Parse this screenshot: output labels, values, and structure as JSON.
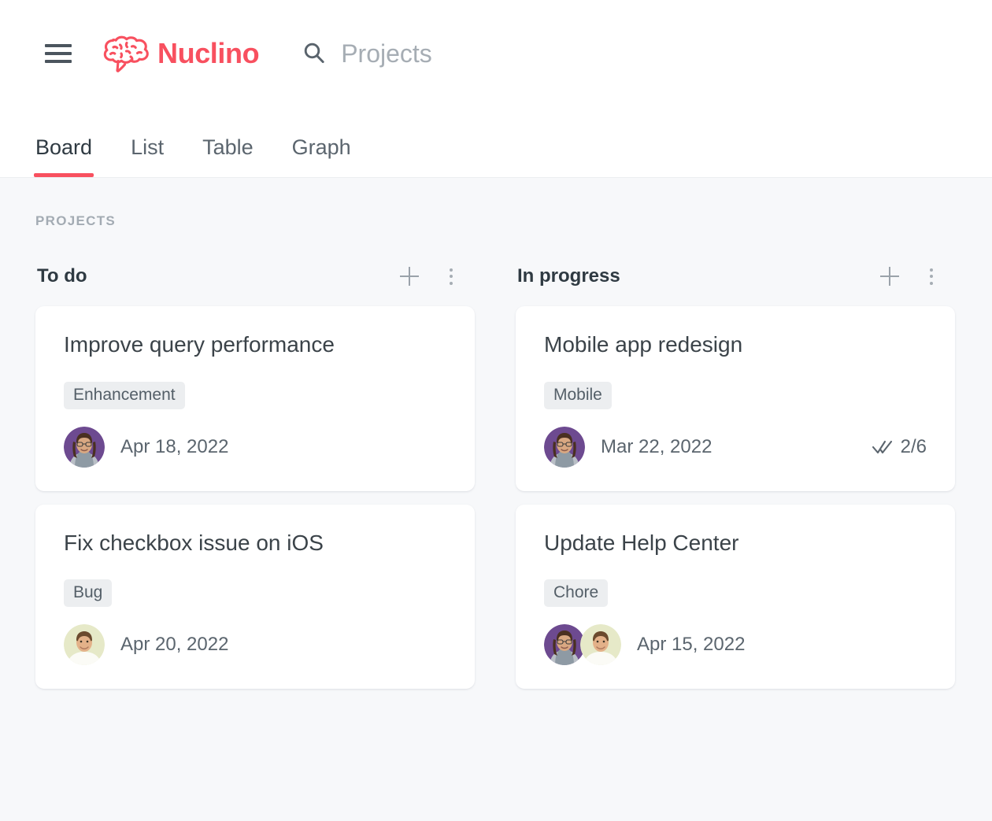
{
  "header": {
    "menu_icon": "hamburger-icon",
    "brand_name": "Nuclino",
    "brand_icon": "brain-speech-bubble-icon",
    "brand_color": "#f8505f",
    "search_icon": "search-icon",
    "search_value": "Projects"
  },
  "tabs": {
    "items": [
      {
        "label": "Board",
        "active": true
      },
      {
        "label": "List",
        "active": false
      },
      {
        "label": "Table",
        "active": false
      },
      {
        "label": "Graph",
        "active": false
      }
    ],
    "overflow_icon": "kebab-menu-icon",
    "active_underline_color": "#f8505f"
  },
  "board": {
    "label": "PROJECTS",
    "background_color": "#f7f8fa",
    "columns": [
      {
        "title": "To do",
        "add_icon": "plus-icon",
        "menu_icon": "kebab-menu-icon",
        "cards": [
          {
            "title": "Improve query performance",
            "tag": "Enhancement",
            "date": "Apr 18, 2022",
            "assignees": [
              "avatar-woman-purple"
            ],
            "progress": null,
            "progress_icon": null
          },
          {
            "title": "Fix checkbox issue on iOS",
            "tag": "Bug",
            "date": "Apr 20, 2022",
            "assignees": [
              "avatar-man-cream"
            ],
            "progress": null,
            "progress_icon": null
          }
        ]
      },
      {
        "title": "In progress",
        "add_icon": "plus-icon",
        "menu_icon": "kebab-menu-icon",
        "cards": [
          {
            "title": "Mobile app redesign",
            "tag": "Mobile",
            "date": "Mar 22, 2022",
            "assignees": [
              "avatar-woman-purple"
            ],
            "progress": "2/6",
            "progress_icon": "double-check-icon"
          },
          {
            "title": "Update Help Center",
            "tag": "Chore",
            "date": "Apr 15, 2022",
            "assignees": [
              "avatar-woman-purple",
              "avatar-man-cream"
            ],
            "progress": null,
            "progress_icon": null
          }
        ]
      }
    ]
  }
}
